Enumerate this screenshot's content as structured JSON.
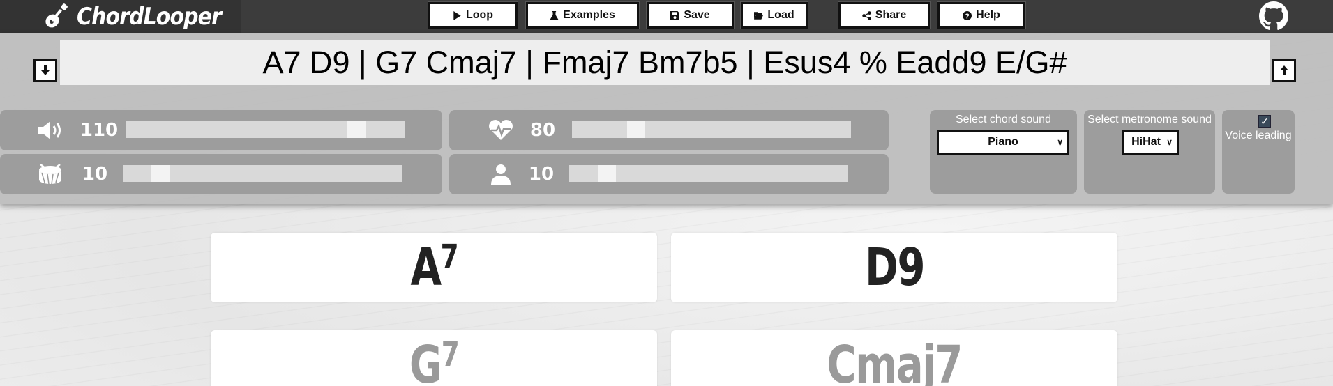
{
  "app": {
    "title": "ChordLooper"
  },
  "nav": {
    "buttons": [
      {
        "label": "Loop",
        "icon": "play-icon"
      },
      {
        "label": "Examples",
        "icon": "flask-icon"
      },
      {
        "label": "Save",
        "icon": "floppy-icon"
      },
      {
        "label": "Load",
        "icon": "folder-open-icon"
      },
      {
        "label": "Share",
        "icon": "share-icon"
      },
      {
        "label": "Help",
        "icon": "question-circle-icon"
      }
    ],
    "github_icon": "github-icon"
  },
  "progression": {
    "text": "A7 D9 | G7 Cmaj7 | Fmaj7 Bm7b5 | Esus4 % Eadd9 E/G#"
  },
  "sliders": [
    {
      "icon": "volume-icon",
      "value": "110",
      "level": 0.85
    },
    {
      "icon": "heartbeat-icon",
      "value": "80",
      "level": 0.21
    },
    {
      "icon": "drum-icon",
      "value": "10",
      "level": 0.11
    },
    {
      "icon": "user-icon",
      "value": "10",
      "level": 0.11
    }
  ],
  "options": {
    "chord_sound_label": "Select chord sound",
    "chord_sound_value": "Piano",
    "metronome_sound_label": "Select metronome sound",
    "metronome_sound_value": "HiHat",
    "voice_leading_label": "Voice leading",
    "voice_leading_checked": true
  },
  "chords": [
    {
      "root": "A",
      "ext": "7",
      "active": true
    },
    {
      "root": "D",
      "ext": "9",
      "active": true
    },
    {
      "root": "G",
      "ext": "7",
      "active": false
    },
    {
      "root": "Cmaj7",
      "ext": "",
      "active": false
    }
  ],
  "colors": {
    "navbar": "#3c3c3c",
    "panel": "#bcbcbc",
    "slider_box": "#919191"
  }
}
